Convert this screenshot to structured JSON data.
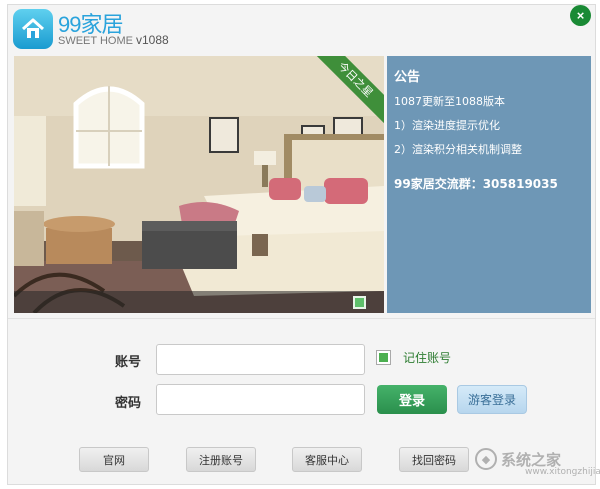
{
  "header": {
    "logo_main": "99家居",
    "logo_sub": "SWEET HOME",
    "version": "v1088",
    "close_label": "×"
  },
  "photo": {
    "ribbon_text": "今日之星"
  },
  "notice": {
    "title": "公告",
    "lines": [
      "1087更新至1088版本",
      "1）渲染进度提示优化",
      "2）渲染积分相关机制调整"
    ],
    "group": "99家居交流群：305819035"
  },
  "login": {
    "account_label": "账号",
    "account_value": "",
    "password_label": "密码",
    "password_value": "",
    "remember_label": "记住账号",
    "remember_checked": true,
    "login_button": "登录",
    "guest_button": "游客登录"
  },
  "footer": {
    "buttons": [
      "官网",
      "注册账号",
      "客服中心",
      "找回密码"
    ]
  },
  "watermark": {
    "text": "系统之家",
    "url": "www.xitongzhijia.net"
  },
  "colors": {
    "brand_blue": "#2aa3dc",
    "notice_bg": "#6e97b6",
    "login_green": "#2a8f4c",
    "close_green": "#1a8a35"
  }
}
